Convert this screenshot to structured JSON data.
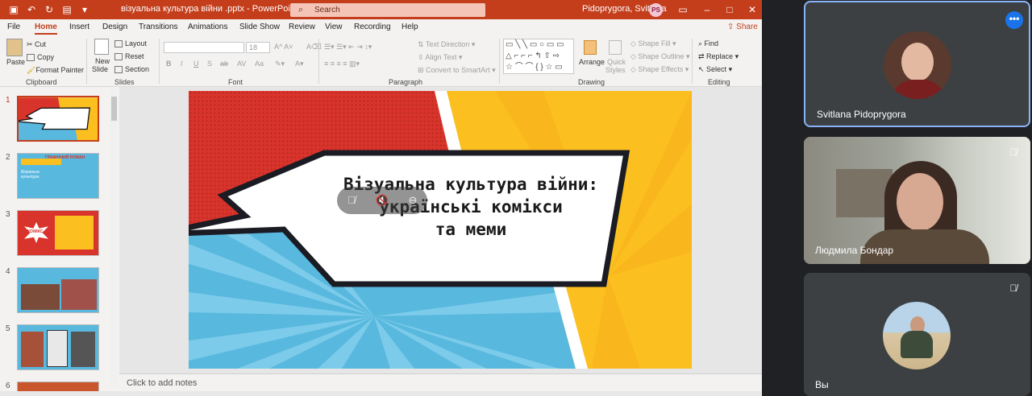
{
  "window": {
    "doc_title": "візуальна культура війни .pptx  -  PowerPoint",
    "search_placeholder": "Search",
    "user_name": "Pidoprygora, Svitlana",
    "user_initials": "PS"
  },
  "menu": {
    "tabs": [
      "File",
      "Home",
      "Insert",
      "Design",
      "Transitions",
      "Animations",
      "Slide Show",
      "Review",
      "View",
      "Recording",
      "Help"
    ],
    "active": "Home",
    "share": "Share"
  },
  "ribbon": {
    "clipboard": {
      "paste": "Paste",
      "cut": "Cut",
      "copy": "Copy",
      "format_painter": "Format Painter",
      "group": "Clipboard"
    },
    "slides": {
      "new_slide": "New",
      "new_slide2": "Slide",
      "layout": "Layout",
      "reset": "Reset",
      "section": "Section",
      "group": "Slides"
    },
    "font": {
      "size": "18",
      "group": "Font"
    },
    "paragraph": {
      "text_direction": "Text Direction",
      "align_text": "Align Text",
      "smartart": "Convert to SmartArt",
      "group": "Paragraph"
    },
    "drawing": {
      "arrange": "Arrange",
      "quick": "Quick",
      "styles": "Styles",
      "shape_fill": "Shape Fill",
      "shape_outline": "Shape Outline",
      "shape_effects": "Shape Effects",
      "group": "Drawing"
    },
    "editing": {
      "find": "Find",
      "replace": "Replace",
      "select": "Select",
      "group": "Editing"
    }
  },
  "slides": {
    "numbers": [
      "1",
      "2",
      "3",
      "4",
      "5",
      "6"
    ],
    "thumb2_heading": "ГРАФІЧНИЙ РОМАН",
    "thumb2_left": "Візуальна культура",
    "thumb3_badge": "КОМІКС"
  },
  "slide": {
    "title_line1": "Візуальна культура війни:",
    "title_line2": "українські комікси",
    "title_line3": "та меми"
  },
  "notes_placeholder": "Click to add notes",
  "participants": [
    {
      "name": "Svitlana Pidoprygora",
      "active": true
    },
    {
      "name": "Людмила Бондар",
      "muted": true
    },
    {
      "name": "Вы",
      "muted": true
    }
  ],
  "colors": {
    "accent": "#c43e1c",
    "slide_red": "#d9342b",
    "slide_yellow": "#fbbf1f",
    "slide_blue": "#58b8de",
    "meet_blue": "#1a73e8"
  }
}
